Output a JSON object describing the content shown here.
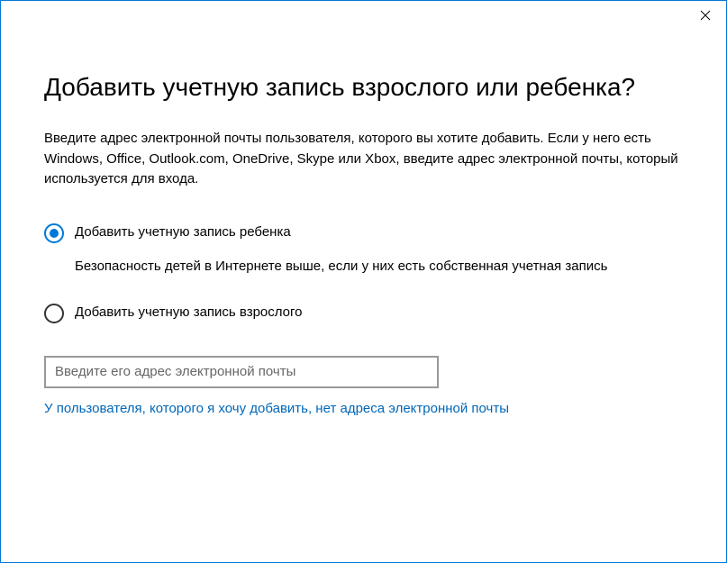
{
  "heading": "Добавить учетную запись взрослого или ребенка?",
  "description": "Введите адрес электронной почты пользователя, которого вы хотите добавить. Если у него есть Windows, Office, Outlook.com, OneDrive, Skype или Xbox, введите адрес электронной почты, который используется для входа.",
  "options": {
    "child": {
      "label": "Добавить учетную запись ребенка",
      "sublabel": "Безопасность детей в Интернете выше, если у них есть собственная учетная запись",
      "selected": true
    },
    "adult": {
      "label": "Добавить учетную запись взрослого",
      "selected": false
    }
  },
  "email": {
    "placeholder": "Введите его адрес электронной почты",
    "value": ""
  },
  "noEmailLink": "У пользователя, которого я хочу добавить, нет адреса электронной почты"
}
